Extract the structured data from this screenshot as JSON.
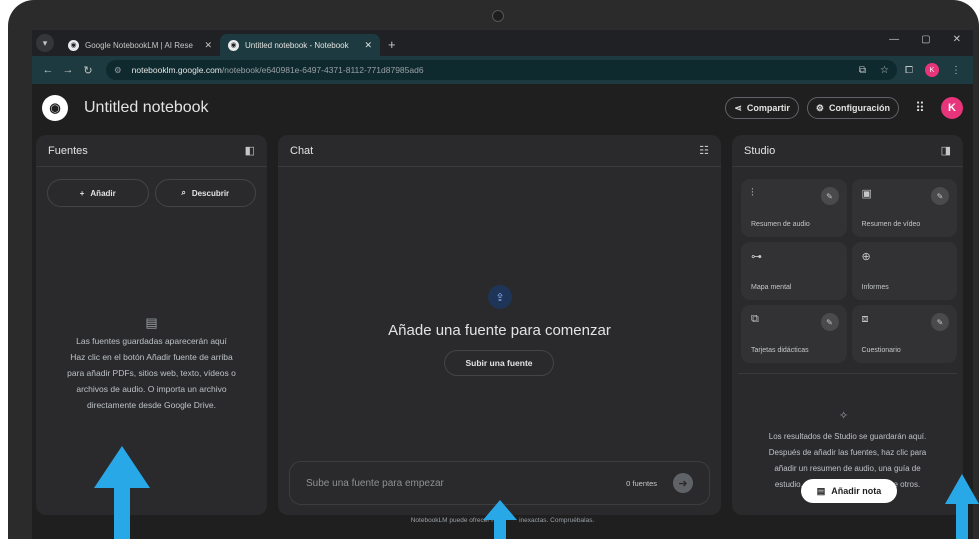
{
  "browser": {
    "tabs": [
      {
        "title": "Google NotebookLM | AI Rese",
        "active": false
      },
      {
        "title": "Untitled notebook - Notebook",
        "active": true
      }
    ],
    "url_host": "notebooklm.google.com",
    "url_path": "/notebook/e640981e-6497-4371-8112-771d87985ad6",
    "profile_letter": "K"
  },
  "header": {
    "title": "Untitled notebook",
    "share_label": "Compartir",
    "settings_label": "Configuración",
    "avatar_letter": "K"
  },
  "sources": {
    "title": "Fuentes",
    "add_label": "Añadir",
    "discover_label": "Descubrir",
    "empty_lines": [
      "Las fuentes guardadas aparecerán aquí",
      "Haz clic en el botón Añadir fuente de arriba",
      "para añadir PDFs, sitios web, texto, vídeos o",
      "archivos de audio. O importa un archivo",
      "directamente desde Google Drive."
    ]
  },
  "chat": {
    "title": "Chat",
    "heading": "Añade una fuente para comenzar",
    "upload_label": "Subir una fuente",
    "input_placeholder": "Sube una fuente para empezar",
    "source_count": "0 fuentes"
  },
  "studio": {
    "title": "Studio",
    "cards": [
      {
        "label": "Resumen de audio",
        "icon": "audio-wave-icon",
        "glyph": "⫶",
        "editable": true
      },
      {
        "label": "Resumen de vídeo",
        "icon": "video-icon",
        "glyph": "▣",
        "editable": true
      },
      {
        "label": "Mapa mental",
        "icon": "mind-map-icon",
        "glyph": "⊶",
        "editable": false
      },
      {
        "label": "Informes",
        "icon": "report-icon",
        "glyph": "⊕",
        "editable": false
      },
      {
        "label": "Tarjetas didácticas",
        "icon": "flashcards-icon",
        "glyph": "⧉",
        "editable": true
      },
      {
        "label": "Cuestionario",
        "icon": "quiz-icon",
        "glyph": "⧈",
        "editable": true
      }
    ],
    "info_lines": [
      "Los resultados de Studio se guardarán aquí.",
      "Después de añadir las fuentes, haz clic para",
      "añadir un resumen de audio, una guía de",
      "estudio,",
      "re otros."
    ],
    "add_note_label": "Añadir nota"
  },
  "footer": {
    "disclaimer_left": "NotebookLM puede ofrecer re",
    "disclaimer_right": "inexactas. Compruébalas."
  },
  "colors": {
    "arrow": "#29a8e8",
    "avatar": "#e8347b",
    "accent_bg": "#1c3a3f"
  }
}
